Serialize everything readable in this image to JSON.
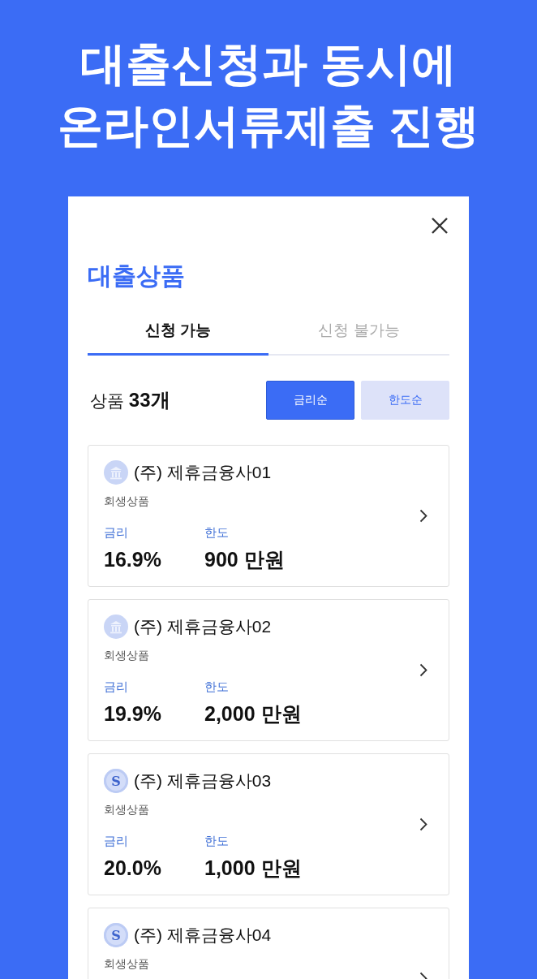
{
  "headline": [
    "대출신청과 동시에",
    "온라인서류제출 진행"
  ],
  "panel": {
    "title": "대출상품",
    "tabs": [
      {
        "label": "신청 가능",
        "selected": true
      },
      {
        "label": "신청 불가능",
        "selected": false
      }
    ],
    "count": "상품 **33개**",
    "sort_buttons": [
      {
        "label": "금리순",
        "selected": true
      },
      {
        "label": "한도순",
        "selected": false
      }
    ],
    "products": [
      {
        "kind": "bank",
        "name": "(주) 제휴금융사01",
        "category": "회생상품",
        "rate_label": "금리",
        "rate": "16.9%",
        "limit_label": "한도",
        "limit": "900 만원"
      },
      {
        "kind": "bank",
        "name": "(주) 제휴금융사02",
        "category": "회생상품",
        "rate_label": "금리",
        "rate": "19.9%",
        "limit_label": "한도",
        "limit": "2,000 만원"
      },
      {
        "kind": "letter",
        "logo_text": "S",
        "name": "(주) 제휴금융사03",
        "category": "회생상품",
        "rate_label": "금리",
        "rate": "20.0%",
        "limit_label": "한도",
        "limit": "1,000 만원"
      },
      {
        "kind": "letter",
        "logo_text": "S",
        "name": "(주) 제휴금융사04",
        "category": "회생상품"
      }
    ]
  }
}
